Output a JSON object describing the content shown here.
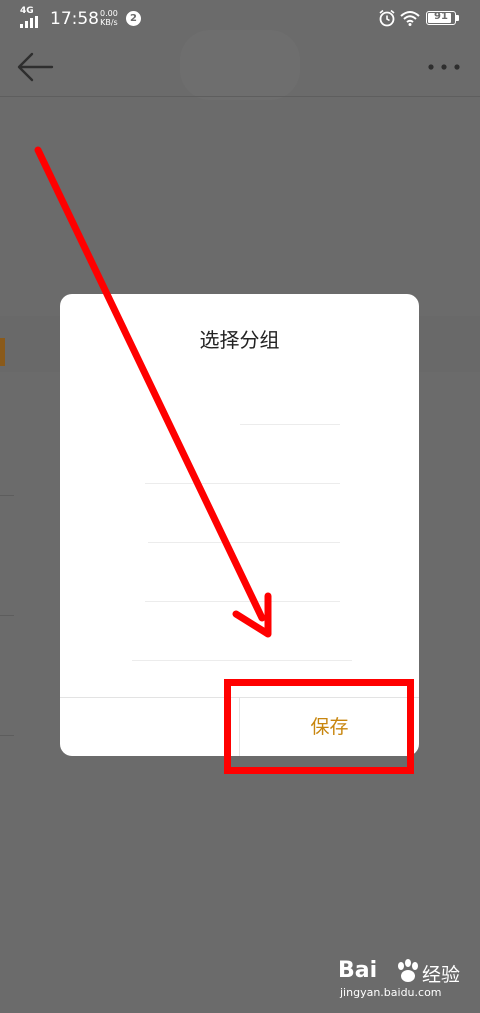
{
  "status_bar": {
    "network": "4G",
    "time": "17:58",
    "speed_value": "0.00",
    "speed_unit": "KB/s",
    "notification_count": "2",
    "battery_level": 91,
    "battery_label": "91"
  },
  "toolbar": {
    "back_icon": "arrow-left-icon",
    "more_icon": "more-dots-icon"
  },
  "dialog": {
    "title": "选择分组",
    "cancel_label": "",
    "save_label": "保存",
    "save_color": "#c8860f"
  },
  "annotation": {
    "color": "#ff0000"
  },
  "watermark": {
    "brand": "Bai",
    "suffix": "经验",
    "url": "jingyan.baidu.com"
  }
}
